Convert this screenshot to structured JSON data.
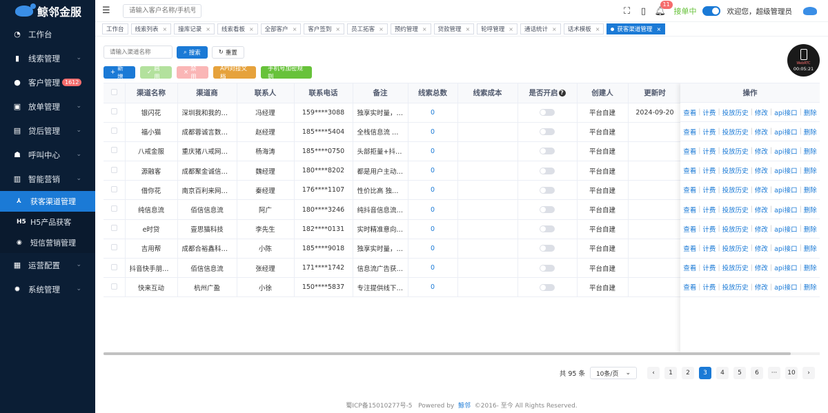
{
  "app": {
    "name": "鲸邻金服"
  },
  "sidebar": {
    "items": [
      {
        "label": "工作台",
        "icon": "dashboard-icon",
        "glyph": "◔"
      },
      {
        "label": "线索管理",
        "icon": "clue-icon",
        "glyph": "▮",
        "chevron": true
      },
      {
        "label": "客户管理",
        "icon": "customer-icon",
        "glyph": "●",
        "chevron": true,
        "badge": "1612"
      },
      {
        "label": "放单管理",
        "icon": "order-icon",
        "glyph": "▣",
        "chevron": true
      },
      {
        "label": "贷后管理",
        "icon": "loan-after-icon",
        "glyph": "▤",
        "chevron": true
      },
      {
        "label": "呼叫中心",
        "icon": "call-center-icon",
        "glyph": "☗",
        "chevron": true
      },
      {
        "label": "智能营销",
        "icon": "marketing-icon",
        "glyph": "▥",
        "chevron": true
      }
    ],
    "subitems": [
      {
        "label": "获客渠道管理",
        "icon": "channel-icon",
        "glyph": "⅄",
        "active": true
      },
      {
        "label": "H5产品获客",
        "icon": "h5-icon",
        "glyph": "H5"
      },
      {
        "label": "短信营销管理",
        "icon": "sms-icon",
        "glyph": "◉"
      }
    ],
    "bottom_items": [
      {
        "label": "运营配置",
        "icon": "ops-config-icon",
        "glyph": "▦",
        "chevron": true
      },
      {
        "label": "系统管理",
        "icon": "settings-icon",
        "glyph": "✹",
        "chevron": true
      }
    ]
  },
  "header": {
    "search_placeholder": "请输入客户名称/手机号",
    "notification_count": "11",
    "status_label": "接单中",
    "welcome": "欢迎您，超级管理员"
  },
  "tabs": [
    {
      "label": "工作台",
      "closable": false
    },
    {
      "label": "线索列表",
      "closable": true
    },
    {
      "label": "撞库记录",
      "closable": true
    },
    {
      "label": "线索看板",
      "closable": true
    },
    {
      "label": "全部客户",
      "closable": true
    },
    {
      "label": "客户签到",
      "closable": true
    },
    {
      "label": "员工拓客",
      "closable": true
    },
    {
      "label": "预约管理",
      "closable": true
    },
    {
      "label": "贷款管理",
      "closable": true
    },
    {
      "label": "轮呼管理",
      "closable": true
    },
    {
      "label": "通话统计",
      "closable": true
    },
    {
      "label": "话术模板",
      "closable": true
    },
    {
      "label": "获客渠道管理",
      "closable": true,
      "active": true
    }
  ],
  "filter": {
    "channel_placeholder": "请输入渠道名称",
    "search_label": "搜索",
    "reset_label": "重置"
  },
  "actions": {
    "add": "新增",
    "enable": "启用",
    "disable": "禁用",
    "api_doc": "API对接文档",
    "phone_rule": "手机号加密规则"
  },
  "float_phone": {
    "status": "WebRTC",
    "time": "00:05:21"
  },
  "table": {
    "headers": [
      "渠道名称",
      "渠道商",
      "联系人",
      "联系电话",
      "备注",
      "线索总数",
      "线索成本",
      "是否开启",
      "创建人",
      "更新时"
    ],
    "ops_header": "操作",
    "ops": [
      "查看",
      "计费",
      "投放历史",
      "修改",
      "api接口",
      "删除"
    ],
    "rows": [
      {
        "name": "银闪花",
        "vendor": "深圳我和我的小...",
        "contact": "冯经理",
        "phone": "159****3088",
        "note": "独享实时量，接...",
        "leads": "0",
        "cost": "",
        "creator": "平台自建",
        "updated": "2024-09-20"
      },
      {
        "name": "福小猫",
        "vendor": "成都蓉诚言数科...",
        "contact": "赵经理",
        "phone": "185****5404",
        "note": "全栈信息流 抖友...",
        "leads": "0",
        "cost": "",
        "creator": "平台自建",
        "updated": ""
      },
      {
        "name": "八戒金服",
        "vendor": "重庆猪八戒网络...",
        "contact": "杨海涛",
        "phone": "185****0750",
        "note": "头部拒量+抖音...",
        "leads": "0",
        "cost": "",
        "creator": "平台自建",
        "updated": ""
      },
      {
        "name": "源融客",
        "vendor": "成都聚金诚信息...",
        "contact": "魏经理",
        "phone": "180****8202",
        "note": "都是用户主动申...",
        "leads": "0",
        "cost": "",
        "creator": "平台自建",
        "updated": ""
      },
      {
        "name": "借你花",
        "vendor": "南京百利来网络...",
        "contact": "秦经理",
        "phone": "176****1107",
        "note": "性价比高 独家一手",
        "leads": "0",
        "cost": "",
        "creator": "平台自建",
        "updated": ""
      },
      {
        "name": "纯信息流",
        "vendor": "佰信信息流",
        "contact": "阿广",
        "phone": "180****3246",
        "note": "纯抖音信息流，...",
        "leads": "0",
        "cost": "",
        "creator": "平台自建",
        "updated": ""
      },
      {
        "name": "e时贷",
        "vendor": "壹思猫科技",
        "contact": "李先生",
        "phone": "182****0131",
        "note": "实时精准意向度...",
        "leads": "0",
        "cost": "",
        "creator": "平台自建",
        "updated": ""
      },
      {
        "name": "吉用帮",
        "vendor": "成都合裕鑫科技...",
        "contact": "小陈",
        "phone": "185****9018",
        "note": "独享实时量，接...",
        "leads": "0",
        "cost": "",
        "creator": "平台自建",
        "updated": ""
      },
      {
        "name": "抖音快手朋友圈",
        "vendor": "佰信信息流",
        "contact": "张经理",
        "phone": "171****1742",
        "note": "信息流广告获客...",
        "leads": "0",
        "cost": "",
        "creator": "平台自建",
        "updated": ""
      },
      {
        "name": "快来互动",
        "vendor": "杭州广盈",
        "contact": "小徐",
        "phone": "150****5837",
        "note": "专注提供线下助...",
        "leads": "0",
        "cost": "",
        "creator": "平台自建",
        "updated": ""
      }
    ]
  },
  "pagination": {
    "total": "共 95 条",
    "page_size": "10条/页",
    "pages": [
      "1",
      "2",
      "3",
      "4",
      "5",
      "6",
      "···",
      "10"
    ],
    "current": "3",
    "prev": "‹",
    "next": "›"
  },
  "footer": {
    "icp": "蜀ICP备15010277号-5",
    "powered": "Powered by",
    "brand": "鲸邻",
    "copyright": "©2016- 至今 All Rights Reserved."
  }
}
